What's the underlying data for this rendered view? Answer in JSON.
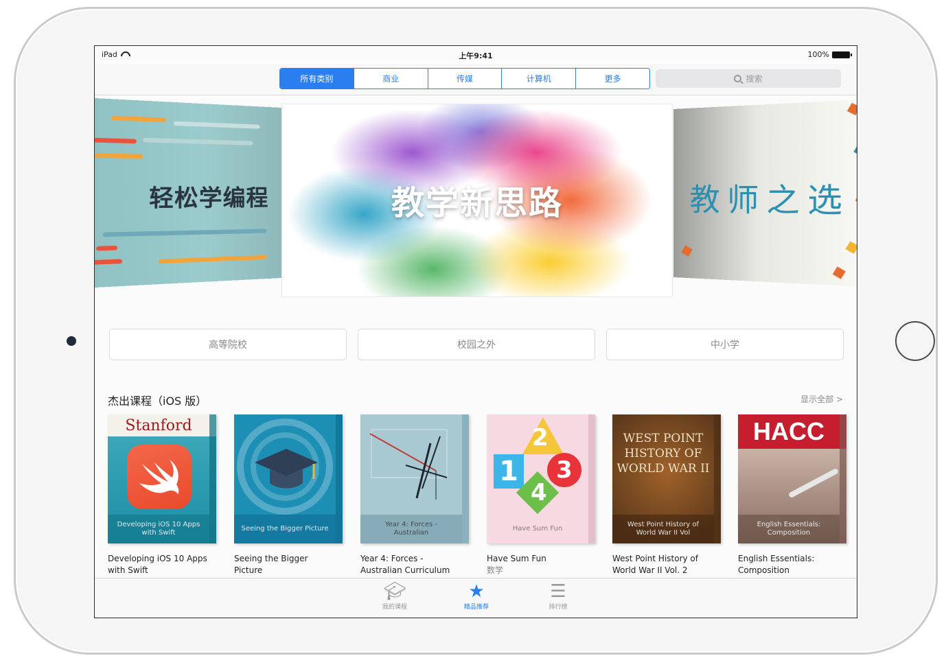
{
  "status_bar": {
    "device": "iPad",
    "time": "上午9:41",
    "battery": "100%"
  },
  "nav": {
    "segments": [
      "所有类别",
      "商业",
      "传媒",
      "计算机",
      "更多"
    ],
    "active_segment": "所有类别",
    "search_placeholder": "搜索"
  },
  "banners": {
    "left": "轻松学编程",
    "center": "教学新思路",
    "right": "教师之选"
  },
  "categories": [
    "高等院校",
    "校园之外",
    "中小学"
  ],
  "section": {
    "title": "杰出课程（iOS 版）",
    "see_all": "显示全部 >"
  },
  "books": [
    {
      "title": "Developing iOS 10 Apps with Swift",
      "cover_text": "Developing iOS 10 Apps with Swift",
      "brand": "Stanford",
      "subtitle": ""
    },
    {
      "title": "Seeing the Bigger Picture",
      "cover_text": "Seeing the Bigger Picture",
      "subtitle": ""
    },
    {
      "title": "Year 4: Forces - Australian Curriculum",
      "cover_text": "Year 4: Forces - Australian",
      "subtitle": ""
    },
    {
      "title": "Have Sum Fun",
      "cover_text": "Have Sum Fun",
      "subtitle": "数学"
    },
    {
      "title": "West Point History of World War II Vol. 2",
      "cover_text": "West Point History of World War II Vol",
      "cover_heading": "WEST POINT HISTORY OF WORLD WAR II",
      "subtitle": ""
    },
    {
      "title": "English Essentials: Composition",
      "cover_text": "English Essentials: Composition",
      "brand": "HACC",
      "subtitle": ""
    }
  ],
  "tabbar": {
    "items": [
      {
        "label": "我的课程",
        "icon": "graduation-cap-icon"
      },
      {
        "label": "精品推荐",
        "icon": "star-icon"
      },
      {
        "label": "排行榜",
        "icon": "list-icon"
      }
    ],
    "active": "精品推荐"
  },
  "colors": {
    "accent": "#2a7ef0"
  }
}
